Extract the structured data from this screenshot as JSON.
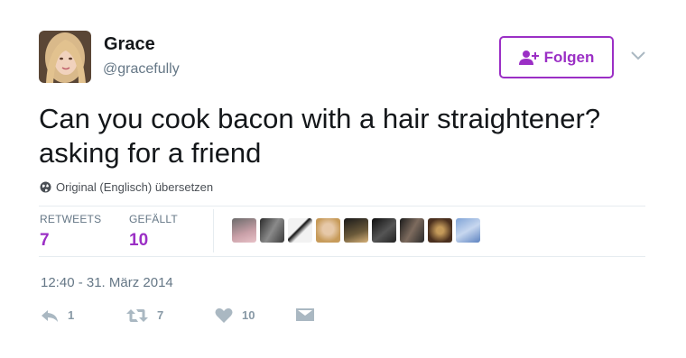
{
  "user": {
    "name": "Grace",
    "handle": "@gracefully"
  },
  "follow_button": {
    "label": "Folgen"
  },
  "tweet": {
    "line1": "Can you cook bacon with a hair straightener?",
    "line2": "asking for a friend"
  },
  "translate": {
    "label": "Original (Englisch) übersetzen"
  },
  "stats": {
    "retweets_label": "RETWEETS",
    "retweets_value": "7",
    "likes_label": "GEFÄLLT",
    "likes_value": "10"
  },
  "timestamp": "12:40 - 31. März 2014",
  "actions": {
    "reply_count": "1",
    "retweet_count": "7",
    "like_count": "10"
  },
  "colors": {
    "accent": "#9b2fc5",
    "secondary_text": "#657786",
    "icon_gray": "#aab8c2"
  },
  "icons": {
    "follow": "add-user-icon",
    "more": "chevron-down-icon",
    "translate": "globe-icon",
    "reply": "reply-icon",
    "retweet": "retweet-icon",
    "like": "heart-icon",
    "message": "direct-message-icon"
  }
}
